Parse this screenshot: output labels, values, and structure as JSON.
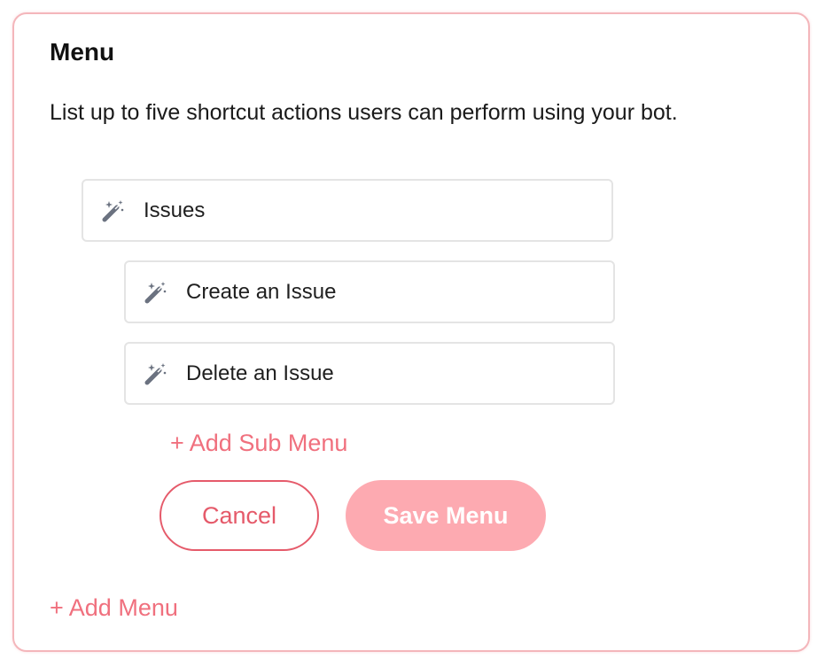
{
  "menu": {
    "title": "Menu",
    "description": "List up to five shortcut actions users can perform using your bot.",
    "items": [
      {
        "label": "Issues",
        "icon": "magic-wand-icon"
      },
      {
        "label": "Create an Issue",
        "icon": "magic-wand-icon"
      },
      {
        "label": "Delete an Issue",
        "icon": "magic-wand-icon"
      }
    ],
    "add_sub_menu_label": "+ Add Sub Menu",
    "cancel_label": "Cancel",
    "save_label": "Save Menu",
    "add_menu_label": "+ Add Menu"
  },
  "colors": {
    "accent": "#f0707e",
    "cancel_border": "#e55a6a",
    "save_bg": "#fdaab1",
    "card_border": "#f4b6bb",
    "icon": "#6b7280"
  }
}
